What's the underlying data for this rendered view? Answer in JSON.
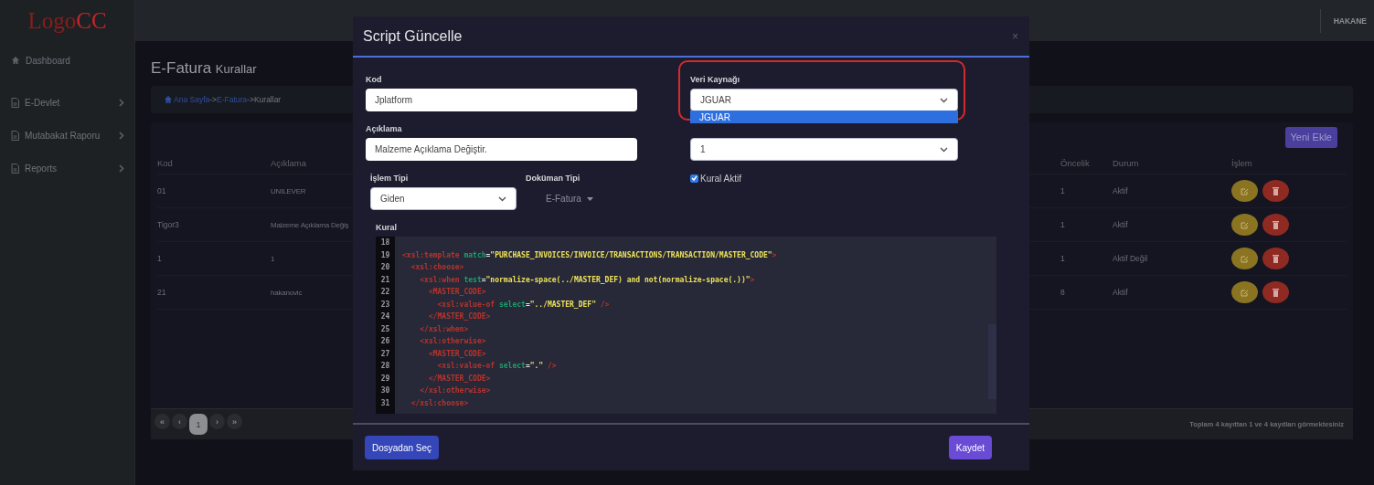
{
  "logo": {
    "text": "Logo",
    "accent": "CC"
  },
  "user": "HAKANE",
  "sidebar": {
    "items": [
      {
        "label": "Dashboard",
        "has_children": false
      },
      {
        "label": "E-Devlet",
        "has_children": true
      },
      {
        "label": "Mutabakat Raporu",
        "has_children": true
      },
      {
        "label": "Reports",
        "has_children": true
      }
    ]
  },
  "page": {
    "title": "E-Fatura",
    "subtitle": "Kurallar",
    "breadcrumb": [
      {
        "text": "Ana Sayfa",
        "link": true
      },
      {
        "text": "->",
        "link": false
      },
      {
        "text": "E-Fatura",
        "link": true
      },
      {
        "text": "->Kurallar",
        "link": false
      }
    ]
  },
  "table": {
    "add_button": "Yeni Ekle",
    "columns": [
      "Kod",
      "Açıklama",
      "Öncelik",
      "Durum",
      "İşlem"
    ],
    "rows": [
      {
        "kod": "01",
        "aciklama": "UNILEVER",
        "oncelik": "1",
        "durum": "Aktif"
      },
      {
        "kod": "Tigor3",
        "aciklama": "Malzeme Açıklama Değiş",
        "oncelik": "1",
        "durum": "Aktif"
      },
      {
        "kod": "1",
        "aciklama": "1",
        "oncelik": "1",
        "durum": "Aktif Değil"
      },
      {
        "kod": "21",
        "aciklama": "hakanovic",
        "oncelik": "8",
        "durum": "Aktif"
      }
    ],
    "pagination": [
      {
        "label": "«",
        "selected": false
      },
      {
        "label": "‹",
        "selected": false
      },
      {
        "label": "1",
        "selected": true
      },
      {
        "label": "›",
        "selected": false
      },
      {
        "label": "»",
        "selected": false
      }
    ],
    "summary": "Toplam 4 kayıttan 1 ve 4 kayıtları görmektesiniz"
  },
  "modal": {
    "title": "Script Güncelle",
    "close": "×",
    "kod": {
      "label": "Kod",
      "value": "Jplatform"
    },
    "veri_kaynagi": {
      "label": "Veri Kaynağı",
      "value": "JGUAR",
      "annotated": true,
      "options": [
        {
          "label": "JGUAR",
          "selected": true
        }
      ]
    },
    "aciklama": {
      "label": "Açıklama",
      "value": "Malzeme Açıklama Değiştir."
    },
    "field_4": {
      "value": "1"
    },
    "islem_tipi": {
      "label": "İşlem Tipi",
      "value": "Giden"
    },
    "dokuman_tipi": {
      "label": "Doküman Tipi",
      "value": "E-Fatura"
    },
    "kural_aktif": {
      "label": "Kural Aktif",
      "checked": true
    },
    "kural": {
      "label": "Kural",
      "lines": [
        {
          "number": "18"
        },
        {
          "number": "19",
          "tokens": [
            {
              "kind": "tag",
              "text": "<xsl:template"
            },
            {
              "kind": "attr",
              "text": " match"
            },
            {
              "kind": "punct",
              "text": "="
            },
            {
              "kind": "string",
              "text": "\"PURCHASE_INVOICES/INVOICE/TRANSACTIONS/TRANSACTION/MASTER_CODE\""
            },
            {
              "kind": "tag",
              "text": ">"
            }
          ]
        },
        {
          "number": "20",
          "tokens": [
            {
              "kind": "tag",
              "text": "  <xsl:choose>"
            }
          ]
        },
        {
          "number": "21",
          "tokens": [
            {
              "kind": "tag",
              "text": "    <xsl:when"
            },
            {
              "kind": "attr",
              "text": " test"
            },
            {
              "kind": "punct",
              "text": "="
            },
            {
              "kind": "string",
              "text": "\"normalize-space(../MASTER_DEF) and not(normalize-space(.))\""
            },
            {
              "kind": "tag",
              "text": ">"
            }
          ]
        },
        {
          "number": "22",
          "tokens": [
            {
              "kind": "tag",
              "text": "      <MASTER_CODE>"
            }
          ]
        },
        {
          "number": "23",
          "tokens": [
            {
              "kind": "tag",
              "text": "        <xsl:value-of"
            },
            {
              "kind": "attr",
              "text": " select"
            },
            {
              "kind": "punct",
              "text": "="
            },
            {
              "kind": "string",
              "text": "\"../MASTER_DEF\""
            },
            {
              "kind": "tag",
              "text": " />"
            }
          ]
        },
        {
          "number": "24",
          "tokens": [
            {
              "kind": "tag",
              "text": "      </MASTER_CODE>"
            }
          ]
        },
        {
          "number": "25",
          "tokens": [
            {
              "kind": "tag",
              "text": "    </xsl:when>"
            }
          ]
        },
        {
          "number": "26",
          "tokens": [
            {
              "kind": "tag",
              "text": "    <xsl:otherwise>"
            }
          ]
        },
        {
          "number": "27",
          "tokens": [
            {
              "kind": "tag",
              "text": "      <MASTER_CODE>"
            }
          ]
        },
        {
          "number": "28",
          "tokens": [
            {
              "kind": "tag",
              "text": "        <xsl:value-of"
            },
            {
              "kind": "attr",
              "text": " select"
            },
            {
              "kind": "punct",
              "text": "="
            },
            {
              "kind": "string",
              "text": "\".\""
            },
            {
              "kind": "tag",
              "text": " />"
            }
          ]
        },
        {
          "number": "29",
          "tokens": [
            {
              "kind": "tag",
              "text": "      </MASTER_CODE>"
            }
          ]
        },
        {
          "number": "30",
          "tokens": [
            {
              "kind": "tag",
              "text": "    </xsl:otherwise>"
            }
          ]
        },
        {
          "number": "31",
          "tokens": [
            {
              "kind": "tag",
              "text": "  </xsl:choose>"
            }
          ]
        }
      ]
    },
    "buttons": [
      {
        "label": "Dosyadan Seç",
        "kind": "file"
      },
      {
        "label": "Kaydet",
        "kind": "primary"
      }
    ]
  }
}
